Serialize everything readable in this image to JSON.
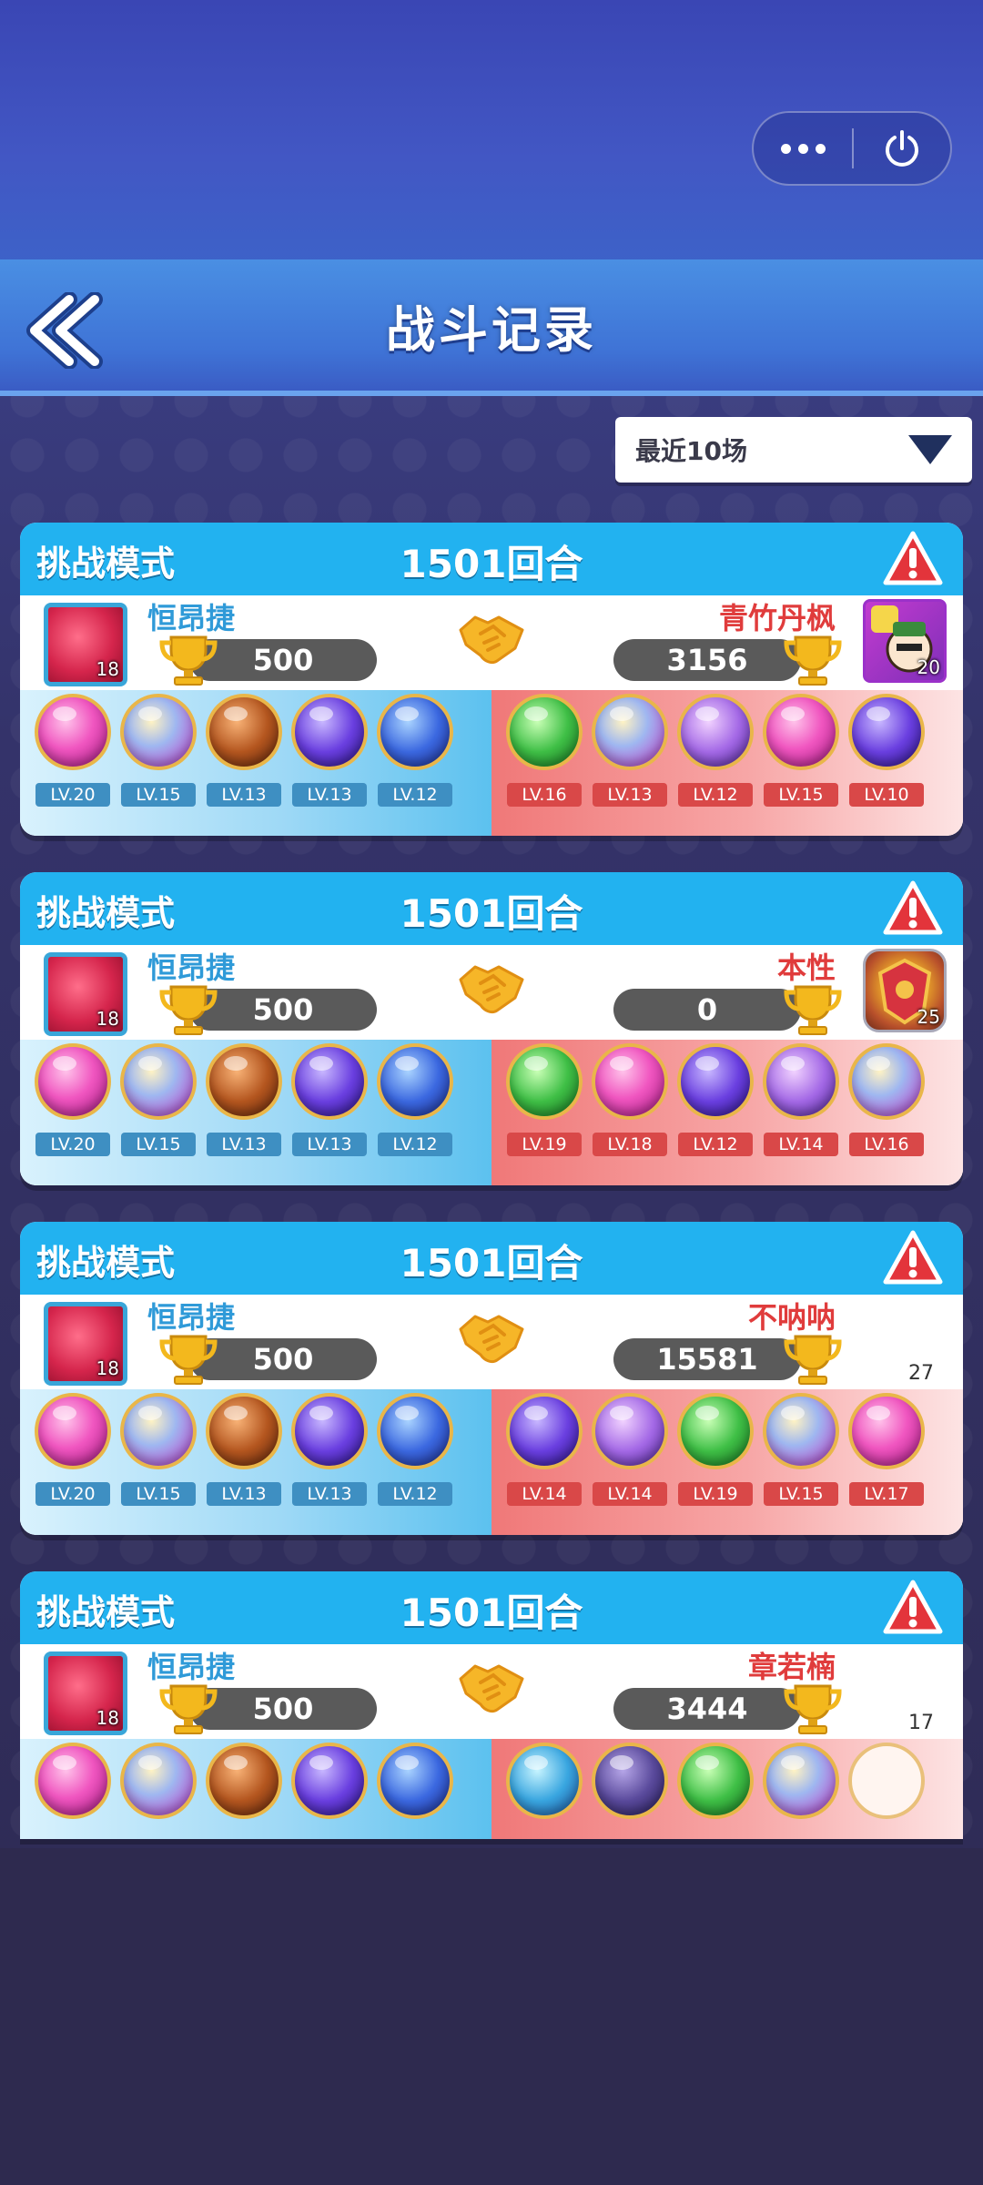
{
  "page": {
    "title": "战斗记录"
  },
  "capsule": {
    "more_icon": "more-dots-icon",
    "power_icon": "power-icon"
  },
  "filter": {
    "label": "最近10场",
    "icon": "dropdown-triangle-icon"
  },
  "colors": {
    "mode_header": "#22b2f0",
    "my_name": "#2f9ad8",
    "opp_name": "#e03c3c"
  },
  "records": [
    {
      "mode": "挑战模式",
      "rounds": "1501回合",
      "me": {
        "name": "恒昂捷",
        "trophies": "500",
        "avatar_level": "18"
      },
      "opponent": {
        "name": "青竹丹枫",
        "trophies": "3156",
        "avatar_level": "20",
        "avatar_style": "bears"
      },
      "my_pets": [
        {
          "lv": "LV.20",
          "color": "pink"
        },
        {
          "lv": "LV.15",
          "color": "opal"
        },
        {
          "lv": "LV.13",
          "color": "bronze"
        },
        {
          "lv": "LV.13",
          "color": "violet"
        },
        {
          "lv": "LV.12",
          "color": "blue"
        }
      ],
      "opp_pets": [
        {
          "lv": "LV.16",
          "color": "green"
        },
        {
          "lv": "LV.13",
          "color": "opal"
        },
        {
          "lv": "LV.12",
          "color": "lilac"
        },
        {
          "lv": "LV.15",
          "color": "pink"
        },
        {
          "lv": "LV.10",
          "color": "violet"
        }
      ]
    },
    {
      "mode": "挑战模式",
      "rounds": "1501回合",
      "me": {
        "name": "恒昂捷",
        "trophies": "500",
        "avatar_level": "18"
      },
      "opponent": {
        "name": "本性",
        "trophies": "0",
        "avatar_level": "25",
        "avatar_style": "crest"
      },
      "my_pets": [
        {
          "lv": "LV.20",
          "color": "pink"
        },
        {
          "lv": "LV.15",
          "color": "opal"
        },
        {
          "lv": "LV.13",
          "color": "bronze"
        },
        {
          "lv": "LV.13",
          "color": "violet"
        },
        {
          "lv": "LV.12",
          "color": "blue"
        }
      ],
      "opp_pets": [
        {
          "lv": "LV.19",
          "color": "green"
        },
        {
          "lv": "LV.18",
          "color": "pink"
        },
        {
          "lv": "LV.12",
          "color": "violet"
        },
        {
          "lv": "LV.14",
          "color": "lilac"
        },
        {
          "lv": "LV.16",
          "color": "opal"
        }
      ]
    },
    {
      "mode": "挑战模式",
      "rounds": "1501回合",
      "me": {
        "name": "恒昂捷",
        "trophies": "500",
        "avatar_level": "18"
      },
      "opponent": {
        "name": "不呐呐",
        "trophies": "15581",
        "avatar_level": "27",
        "avatar_style": "none"
      },
      "my_pets": [
        {
          "lv": "LV.20",
          "color": "pink"
        },
        {
          "lv": "LV.15",
          "color": "opal"
        },
        {
          "lv": "LV.13",
          "color": "bronze"
        },
        {
          "lv": "LV.13",
          "color": "violet"
        },
        {
          "lv": "LV.12",
          "color": "blue"
        }
      ],
      "opp_pets": [
        {
          "lv": "LV.14",
          "color": "violet"
        },
        {
          "lv": "LV.14",
          "color": "lilac"
        },
        {
          "lv": "LV.19",
          "color": "green"
        },
        {
          "lv": "LV.15",
          "color": "opal"
        },
        {
          "lv": "LV.17",
          "color": "pink"
        }
      ]
    },
    {
      "mode": "挑战模式",
      "rounds": "1501回合",
      "me": {
        "name": "恒昂捷",
        "trophies": "500",
        "avatar_level": "18"
      },
      "opponent": {
        "name": "章若楠",
        "trophies": "3444",
        "avatar_level": "17",
        "avatar_style": "none"
      },
      "my_pets": [
        {
          "lv": "",
          "color": "pink"
        },
        {
          "lv": "",
          "color": "opal"
        },
        {
          "lv": "",
          "color": "bronze"
        },
        {
          "lv": "",
          "color": "violet"
        },
        {
          "lv": "",
          "color": "blue"
        }
      ],
      "opp_pets": [
        {
          "lv": "",
          "color": "teal"
        },
        {
          "lv": "",
          "color": "shadow"
        },
        {
          "lv": "",
          "color": "green"
        },
        {
          "lv": "",
          "color": "opal"
        },
        {
          "lv": "",
          "color": "empty"
        }
      ]
    }
  ]
}
